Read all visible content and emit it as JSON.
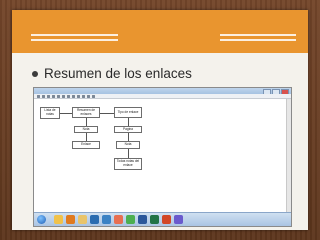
{
  "slide": {
    "title": "Resumen de los enlaces",
    "colors": {
      "frame": "#6b3f22",
      "banner": "#e9952f",
      "slide_bg": "#f4f2ec"
    }
  },
  "screenshot": {
    "window_title": "",
    "nodes": [
      {
        "id": "n1",
        "text": "Lista de notas"
      },
      {
        "id": "n2",
        "text": "Resumen de enlaces"
      },
      {
        "id": "n3",
        "text": "Tipo de enlace"
      },
      {
        "id": "n4",
        "text": "Nota"
      },
      {
        "id": "n5",
        "text": "Pagina"
      },
      {
        "id": "n6",
        "text": "Enlace"
      },
      {
        "id": "n7",
        "text": "Nota"
      },
      {
        "id": "n8",
        "text": "Todas notas del enlace"
      }
    ],
    "taskbar_icons": [
      "explorer-icon",
      "media-icon",
      "folder-icon",
      "browser-icon",
      "ie-icon",
      "firefox-icon",
      "chrome-icon",
      "word-icon",
      "excel-icon",
      "powerpoint-icon",
      "app-icon"
    ],
    "clock": {
      "time": "",
      "date": ""
    }
  }
}
